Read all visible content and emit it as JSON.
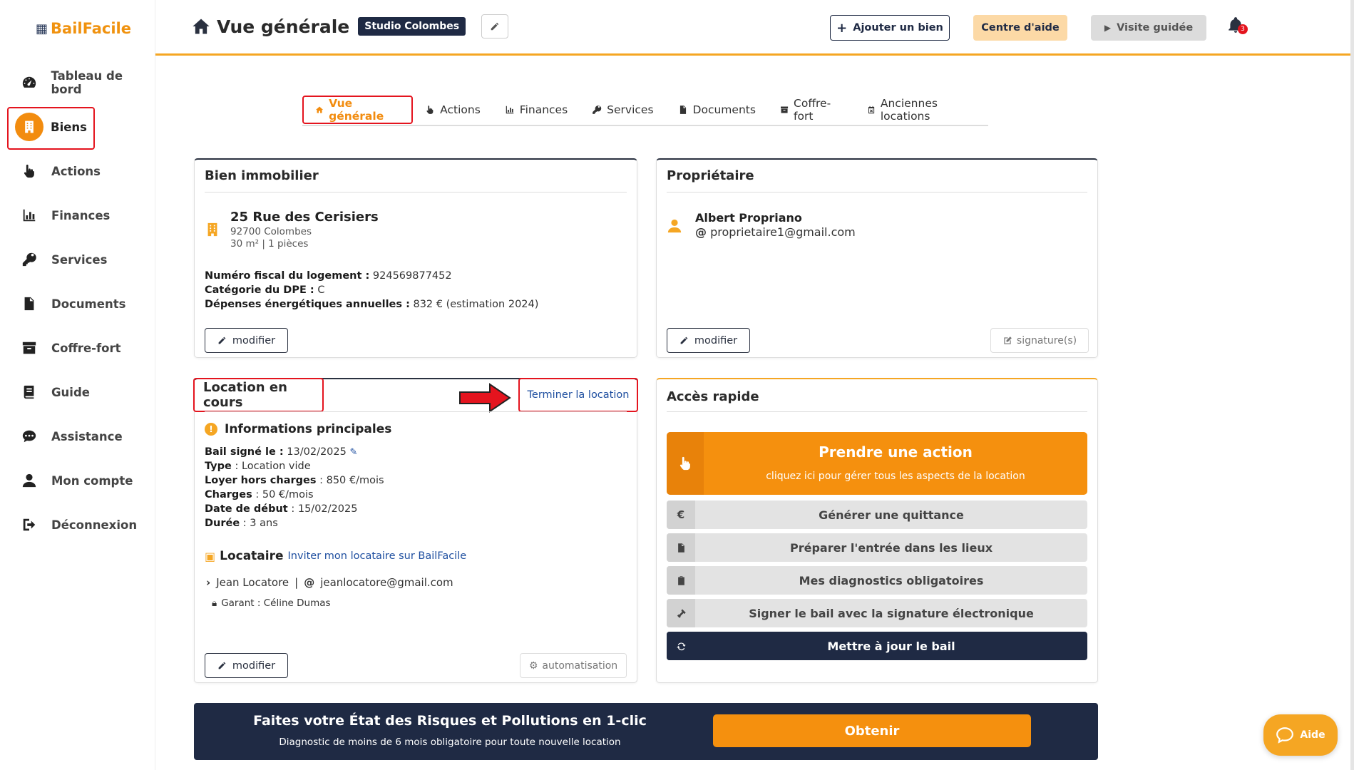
{
  "app": {
    "logo_text": "BailFacile"
  },
  "sidebar": {
    "items": [
      {
        "label": "Tableau de bord",
        "icon": "gauge-icon"
      },
      {
        "label": "Biens",
        "icon": "building-icon",
        "active": true
      },
      {
        "label": "Actions",
        "icon": "hand-pointer-icon"
      },
      {
        "label": "Finances",
        "icon": "bar-chart-icon"
      },
      {
        "label": "Services",
        "icon": "key-icon"
      },
      {
        "label": "Documents",
        "icon": "document-icon"
      },
      {
        "label": "Coffre-fort",
        "icon": "archive-icon"
      },
      {
        "label": "Guide",
        "icon": "book-icon"
      },
      {
        "label": "Assistance",
        "icon": "chat-icon"
      },
      {
        "label": "Mon compte",
        "icon": "user-icon"
      },
      {
        "label": "Déconnexion",
        "icon": "logout-icon"
      }
    ]
  },
  "header": {
    "title": "Vue générale",
    "property_badge": "Studio Colombes",
    "add_property": "Ajouter un bien",
    "help_center": "Centre d'aide",
    "guided_tour": "Visite guidée",
    "notification_count": "3"
  },
  "tabs": [
    {
      "label": "Vue générale",
      "active": true
    },
    {
      "label": "Actions"
    },
    {
      "label": "Finances"
    },
    {
      "label": "Services"
    },
    {
      "label": "Documents"
    },
    {
      "label": "Coffre-fort"
    },
    {
      "label": "Anciennes locations"
    }
  ],
  "bien": {
    "title": "Bien immobilier",
    "address": "25 Rue des Cerisiers",
    "city": "92700 Colombes",
    "surface": "30 m² | 1 pièces",
    "fiscal_label": "Numéro fiscal du logement :",
    "fiscal_value": "924569877452",
    "dpe_label": "Catégorie du DPE :",
    "dpe_value": "C",
    "energy_label": "Dépenses énergétiques annuelles :",
    "energy_value": "832 € (estimation 2024)",
    "edit": "modifier"
  },
  "owner": {
    "title": "Propriétaire",
    "name": "Albert Propriano",
    "email": "proprietaire1@gmail.com",
    "edit": "modifier",
    "signatures": "signature(s)"
  },
  "location": {
    "title": "Location en cours",
    "end_link": "Terminer la location",
    "main_info": "Informations principales",
    "lease_signed_label": "Bail signé le :",
    "lease_signed_value": "13/02/2025",
    "type_label": "Type",
    "type_value": ": Location vide",
    "rent_label": "Loyer hors charges",
    "rent_value": ": 850 €/mois",
    "charges_label": "Charges",
    "charges_value": ": 50 €/mois",
    "start_label": "Date de début",
    "start_value": ": 15/02/2025",
    "duration_label": "Durée",
    "duration_value": ": 3 ans",
    "tenant_heading": "Locataire",
    "invite_link": "Inviter mon locataire sur BailFacile",
    "tenant_name": "Jean Locatore",
    "tenant_email": "jeanlocatore@gmail.com",
    "guarantor": "Garant : Céline Dumas",
    "edit": "modifier",
    "automation": "automatisation"
  },
  "quick_access": {
    "title": "Accès rapide",
    "main_action": "Prendre une action",
    "main_action_sub": "cliquez ici pour gérer tous les aspects de la location",
    "items": [
      {
        "label": "Générer une quittance",
        "icon": "euro-icon"
      },
      {
        "label": "Préparer l'entrée dans les lieux",
        "icon": "document-icon"
      },
      {
        "label": "Mes diagnostics obligatoires",
        "icon": "clipboard-check-icon"
      },
      {
        "label": "Signer le bail avec la signature électronique",
        "icon": "gavel-icon"
      },
      {
        "label": "Mettre à jour le bail",
        "icon": "refresh-icon"
      }
    ]
  },
  "banner": {
    "heading": "Faites votre État des Risques et Pollutions en 1-clic",
    "sub": "Diagnostic de moins de 6 mois obligatoire pour toute nouvelle location",
    "cta": "Obtenir"
  },
  "help_widget": {
    "label": "Aide"
  },
  "colors": {
    "accent": "#f5900e",
    "navy": "#1f2a44",
    "highlight_red": "#e4141e",
    "link_blue": "#1f4fa0"
  }
}
